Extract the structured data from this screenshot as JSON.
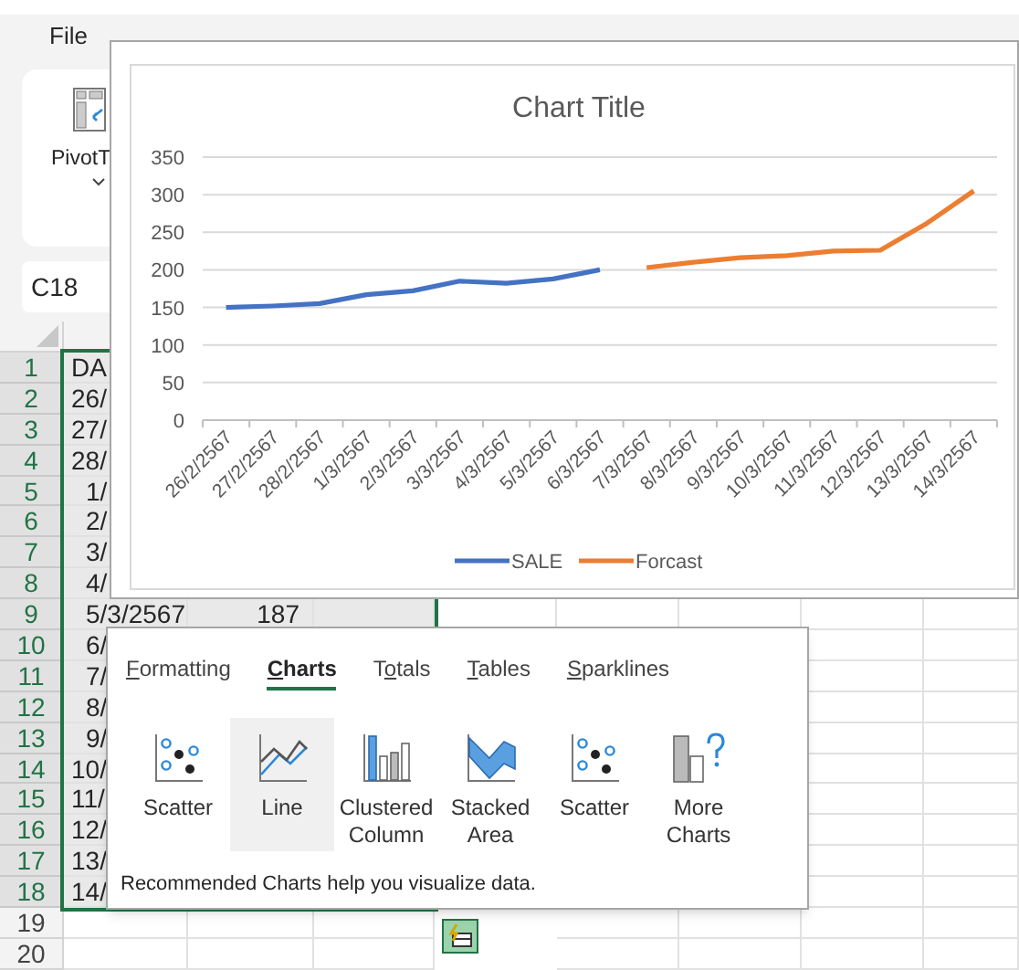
{
  "ribbon": {
    "tab": "File",
    "pivot_button": "PivotT"
  },
  "name_box": "C18",
  "sheet": {
    "rows": [
      {
        "number": "1",
        "selected": true,
        "cells": [
          {
            "text": "DA",
            "indent": false
          }
        ]
      },
      {
        "number": "2",
        "selected": true,
        "cells": [
          {
            "text": "26/",
            "indent": false
          }
        ]
      },
      {
        "number": "3",
        "selected": true,
        "cells": [
          {
            "text": "27/",
            "indent": false
          }
        ]
      },
      {
        "number": "4",
        "selected": true,
        "cells": [
          {
            "text": "28/",
            "indent": false
          }
        ]
      },
      {
        "number": "5",
        "selected": true,
        "cells": [
          {
            "text": "1/",
            "indent": true
          }
        ]
      },
      {
        "number": "6",
        "selected": true,
        "cells": [
          {
            "text": "2/",
            "indent": true
          }
        ]
      },
      {
        "number": "7",
        "selected": true,
        "cells": [
          {
            "text": "3/",
            "indent": true
          }
        ]
      },
      {
        "number": "8",
        "selected": true,
        "cells": [
          {
            "text": "4/",
            "indent": true
          }
        ]
      },
      {
        "number": "9",
        "selected": true,
        "cells": [
          {
            "text": "5/3/2567",
            "indent": true
          },
          {
            "text": "187"
          }
        ]
      },
      {
        "number": "10",
        "selected": true,
        "cells": [
          {
            "text": "6/",
            "indent": true
          }
        ]
      },
      {
        "number": "11",
        "selected": true,
        "cells": [
          {
            "text": "7/",
            "indent": true
          }
        ]
      },
      {
        "number": "12",
        "selected": true,
        "cells": [
          {
            "text": "8/",
            "indent": true
          }
        ]
      },
      {
        "number": "13",
        "selected": true,
        "cells": [
          {
            "text": "9/",
            "indent": true
          }
        ]
      },
      {
        "number": "14",
        "selected": true,
        "cells": [
          {
            "text": "10/",
            "indent": false
          }
        ]
      },
      {
        "number": "15",
        "selected": true,
        "cells": [
          {
            "text": "11/",
            "indent": false
          }
        ]
      },
      {
        "number": "16",
        "selected": true,
        "cells": [
          {
            "text": "12/",
            "indent": false
          }
        ]
      },
      {
        "number": "17",
        "selected": true,
        "cells": [
          {
            "text": "13/",
            "indent": false
          }
        ]
      },
      {
        "number": "18",
        "selected": true,
        "cells": [
          {
            "text": "14/",
            "indent": false
          }
        ]
      },
      {
        "number": "19",
        "selected": false
      },
      {
        "number": "20",
        "selected": false
      }
    ]
  },
  "chart": {
    "chart_data": {
      "type": "line",
      "title": "Chart Title",
      "categories": [
        "26/2/2567",
        "27/2/2567",
        "28/2/2567",
        "1/3/2567",
        "2/3/2567",
        "3/3/2567",
        "4/3/2567",
        "5/3/2567",
        "6/3/2567",
        "7/3/2567",
        "8/3/2567",
        "9/3/2567",
        "10/3/2567",
        "11/3/2567",
        "12/3/2567",
        "13/3/2567",
        "14/3/2567"
      ],
      "series": [
        {
          "name": "SALE",
          "color": "#4472c4",
          "values": [
            150,
            152,
            155,
            167,
            172,
            185,
            182,
            188,
            200,
            null,
            null,
            null,
            null,
            null,
            null,
            null,
            null
          ]
        },
        {
          "name": "Forcast",
          "color": "#ed7d31",
          "values": [
            null,
            null,
            null,
            null,
            null,
            null,
            null,
            null,
            null,
            203,
            210,
            216,
            219,
            225,
            226,
            262,
            305
          ]
        }
      ],
      "grid": true,
      "legend": true,
      "ylim": [
        0,
        350
      ],
      "yticks": [
        0,
        50,
        100,
        150,
        200,
        250,
        300,
        350
      ]
    }
  },
  "quick_analysis": {
    "tabs": [
      {
        "key": "F",
        "post": "ormatting",
        "selected": false
      },
      {
        "key": "C",
        "post": "harts",
        "selected": true
      },
      {
        "pre": "T",
        "key": "o",
        "post": "tals",
        "selected": false
      },
      {
        "key": "T",
        "post": "ables",
        "selected": false
      },
      {
        "key": "S",
        "post": "parklines",
        "selected": false
      }
    ],
    "options": [
      {
        "kind": "scatter",
        "label": "Scatter",
        "selected": false
      },
      {
        "kind": "line",
        "label": "Line",
        "selected": true
      },
      {
        "kind": "column",
        "label": "Clustered Column",
        "selected": false
      },
      {
        "kind": "area",
        "label": "Stacked Area",
        "selected": false
      },
      {
        "kind": "scatter",
        "label": "Scatter",
        "selected": false
      },
      {
        "kind": "more",
        "label": "More Charts",
        "selected": false
      }
    ],
    "footer": "Recommended Charts help you visualize data."
  }
}
